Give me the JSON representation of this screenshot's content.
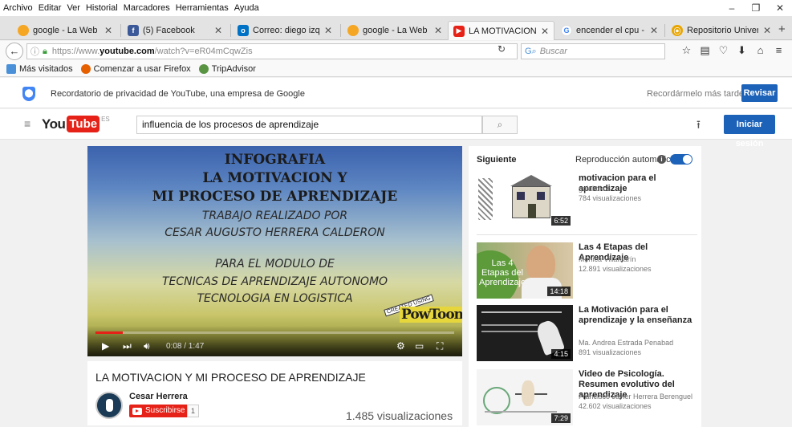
{
  "menu": [
    "Archivo",
    "Editar",
    "Ver",
    "Historial",
    "Marcadores",
    "Herramientas",
    "Ayuda"
  ],
  "window_controls": [
    "–",
    "❐",
    "✕"
  ],
  "tabs": [
    {
      "label": "google - La Web",
      "icon_color": "#f5a623",
      "icon": "google-icon"
    },
    {
      "label": "(5) Facebook",
      "icon_color": "#3b5998",
      "icon": "facebook-icon"
    },
    {
      "label": "Correo: diego izquier...",
      "icon_color": "#0072c6",
      "icon": "outlook-icon"
    },
    {
      "label": "google - La Web",
      "icon_color": "#f5a623",
      "icon": "google-icon"
    },
    {
      "label": "LA MOTIVACION Y ...",
      "icon_color": "#e62117",
      "icon": "youtube-icon"
    },
    {
      "label": "encender el cpu - Bus...",
      "icon_color": "#4285f4",
      "icon": "google-g-icon"
    },
    {
      "label": "Repositorio Universid...",
      "icon_color": "#e8a500",
      "icon": "repository-icon"
    }
  ],
  "new_tab_label": "+",
  "nav": {
    "url_prefix": "https://www.",
    "url_domain": "youtube.com",
    "url_path": "/watch?v=eR04mCqwZis",
    "search_placeholder": "Buscar"
  },
  "bookmarks": [
    {
      "label": "Más visitados",
      "color": "#4a90d9"
    },
    {
      "label": "Comenzar a usar Firefox",
      "color": "#e66000"
    },
    {
      "label": "TripAdvisor",
      "color": "#589442"
    }
  ],
  "youtube": {
    "privacy_text": "Recordatorio de privacidad de YouTube, una empresa de Google",
    "remind_later": "Recordármelo más tarde",
    "review_button": "Revisar",
    "logo_you": "You",
    "logo_tube": "Tube",
    "logo_region": "ES",
    "search_value": "influencia de los procesos de aprendizaje",
    "signin_button": "Iniciar sesión",
    "brand_red": "#e62117",
    "brand_blue": "#1c62b9"
  },
  "video": {
    "lines": [
      "INFOGRAFIA",
      "LA MOTIVACION Y",
      "MI PROCESO DE APRENDIZAJE",
      "TRABAJO REALIZADO POR",
      "CESAR AUGUSTO HERRERA CALDERON",
      "PARA EL MODULO DE",
      "TECNICAS DE APRENDIZAJE AUTONOMO",
      "TECNOLOGIA EN LOGISTICA"
    ],
    "badge_created": "CREATED USING",
    "badge_name": "PowToon",
    "time": "0:08 / 1:47",
    "progress_fraction": 0.075,
    "title": "LA MOTIVACION Y MI PROCESO DE APRENDIZAJE",
    "channel": "Cesar Herrera",
    "subscribe": "Suscribirse",
    "subscriber_count": "1",
    "views": "1.485 visualizaciones"
  },
  "sidebar": {
    "next_label": "Siguiente",
    "autoplay_label": "Reproducción automática",
    "recommendations": [
      {
        "title": "motivacion para el aprendizaje",
        "author": "galaktikos",
        "views": "784 visualizaciones",
        "duration": "6:52"
      },
      {
        "title": "Las 4 Etapas del Aprendizaje",
        "author": "Mónica Villamarín",
        "views": "12.891 visualizaciones",
        "duration": "14:18",
        "thumb_text": "Las 4 Etapas del Aprendizaje"
      },
      {
        "title": "La Motivación para el aprendizaje y la enseñanza",
        "author": "Ma. Andrea Estrada Penabad",
        "views": "891 visualizaciones",
        "duration": "4:15"
      },
      {
        "title": "Video de Psicología. Resumen evolutivo del aprendizaje",
        "author": "Francisco Javier Herrera Berenguel",
        "views": "42.602 visualizaciones",
        "duration": "7:29"
      }
    ]
  }
}
